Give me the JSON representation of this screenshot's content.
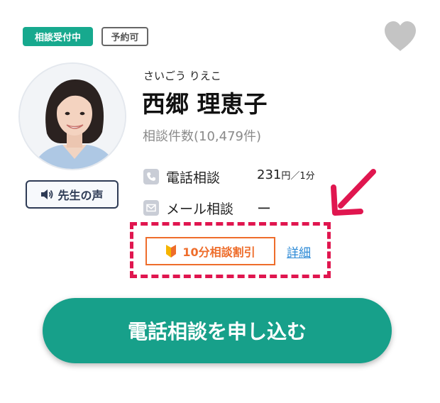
{
  "badges": {
    "status": "相談受付中",
    "reservation": "予約可"
  },
  "favorite": {
    "icon": "heart-icon",
    "color": "#c4c4c4"
  },
  "counselor": {
    "name_kana": "さいごう りえこ",
    "name": "西郷 理恵子",
    "consult_count": "相談件数(10,479件)"
  },
  "voice_button": {
    "icon": "speaker-icon",
    "label": "先生の声"
  },
  "services": {
    "phone": {
      "icon": "phone-icon",
      "label": "電話相談",
      "price": "231",
      "unit": "円／1分"
    },
    "mail": {
      "icon": "mail-icon",
      "label": "メール相談",
      "value": "ー"
    }
  },
  "discount": {
    "icon": "beginner-mark-icon",
    "label": "10分相談割引",
    "detail_link": "詳細"
  },
  "cta": {
    "label": "電話相談を申し込む"
  },
  "colors": {
    "brand": "#17a98e",
    "cta": "#17a08a",
    "discount": "#ee6d2b",
    "highlight": "#e0164f",
    "link": "#2c8ad6"
  }
}
